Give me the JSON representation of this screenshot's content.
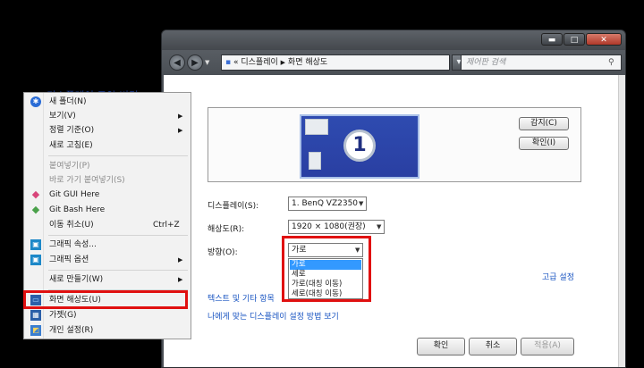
{
  "window": {
    "breadcrumb_prefix": "«",
    "breadcrumb": [
      "디스플레이",
      "화면 해상도"
    ],
    "search_placeholder": "제어판 검색",
    "controls": {
      "minimize": "▬",
      "maximize": "□",
      "close": "✕"
    }
  },
  "display_settings": {
    "heading": "디스플레이 모양 변경",
    "monitor_number": "1",
    "detect_button": "감지(C)",
    "identify_button": "확인(I)",
    "display_label": "디스플레이(S):",
    "display_value": "1. BenQ VZ2350",
    "resolution_label": "해상도(R):",
    "resolution_value": "1920 × 1080(권장)",
    "orientation_label": "방향(O):",
    "orientation_value": "가로",
    "orientation_options": [
      "가로",
      "세로",
      "가로(대칭 이동)",
      "세로(대칭 이동)"
    ],
    "advanced_link": "고급 설정",
    "text_size_link": "텍스트 및 기타 항목",
    "help_link": "나에게 맞는 디스플레이 설정 방법 보기",
    "ok_button": "확인",
    "cancel_button": "취소",
    "apply_button": "적용(A)"
  },
  "context_menu": {
    "items": [
      {
        "label": "새 폴더(N)",
        "icon": "new-folder-icon"
      },
      {
        "label": "보기(V)",
        "submenu": true
      },
      {
        "label": "정렬 기준(O)",
        "submenu": true
      },
      {
        "label": "새로 고침(E)"
      },
      {
        "label": "붙여넣기(P)",
        "disabled": true
      },
      {
        "label": "바로 가기 붙여넣기(S)",
        "disabled": true
      },
      {
        "label": "Git GUI Here",
        "icon": "git-icon"
      },
      {
        "label": "Git Bash Here",
        "icon": "git-icon"
      },
      {
        "label": "이동 취소(U)",
        "shortcut": "Ctrl+Z"
      },
      {
        "label": "그래픽 속성...",
        "icon": "graphics-icon"
      },
      {
        "label": "그래픽 옵션",
        "icon": "graphics-icon",
        "submenu": true
      },
      {
        "label": "새로 만들기(W)",
        "submenu": true
      },
      {
        "label": "화면 해상도(U)",
        "icon": "display-icon",
        "highlighted": true
      },
      {
        "label": "가젯(G)",
        "icon": "gadget-icon"
      },
      {
        "label": "개인 설정(R)",
        "icon": "personalize-icon"
      }
    ]
  },
  "colors": {
    "highlight_box": "#e01010",
    "link": "#1a55c2",
    "heading": "#1e3f99",
    "selection": "#3399ff"
  }
}
